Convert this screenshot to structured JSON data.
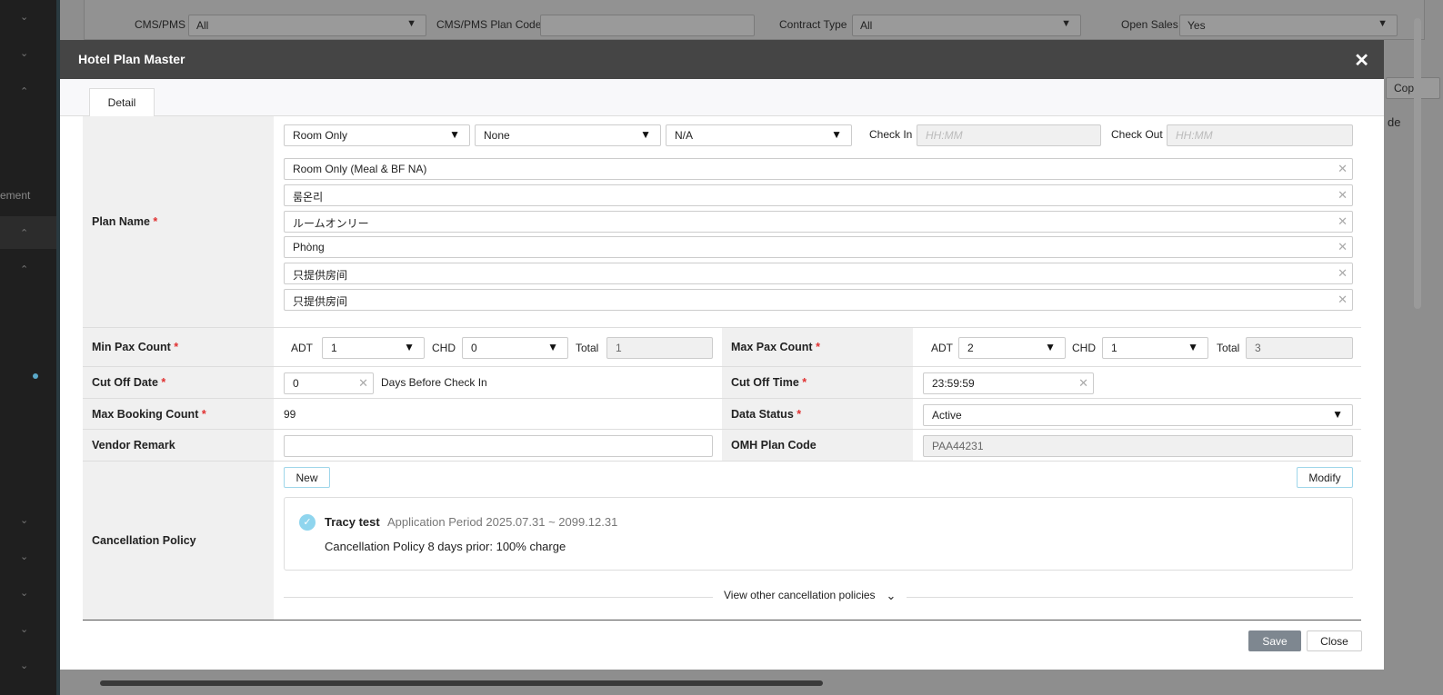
{
  "background": {
    "cms_pms_label": "CMS/PMS",
    "cms_pms_value": "All",
    "plan_code_label": "CMS/PMS Plan Code",
    "contract_type_label": "Contract Type",
    "contract_type_value": "All",
    "open_sales_label": "Open Sales",
    "open_sales_value": "Yes",
    "copy_button": "Copy",
    "col_fragment": "de",
    "sidebar_fragment": "ement"
  },
  "modal": {
    "title": "Hotel Plan Master",
    "close_icon": "close-icon",
    "tab": "Detail"
  },
  "plan": {
    "label": "Plan Name",
    "meal": "Room Only",
    "option2": "None",
    "option3": "N/A",
    "check_in_label": "Check In",
    "check_in_placeholder": "HH:MM",
    "check_out_label": "Check Out",
    "check_out_placeholder": "HH:MM",
    "names": [
      "Room Only (Meal & BF NA)",
      "룸온리",
      "ルームオンリー",
      "Phòng",
      "只提供房间",
      "只提供房间"
    ]
  },
  "min_pax": {
    "label": "Min Pax Count",
    "adt_label": "ADT",
    "adt": "1",
    "chd_label": "CHD",
    "chd": "0",
    "total_label": "Total",
    "total": "1"
  },
  "max_pax": {
    "label": "Max Pax Count",
    "adt_label": "ADT",
    "adt": "2",
    "chd_label": "CHD",
    "chd": "1",
    "total_label": "Total",
    "total": "3"
  },
  "cut_off_date": {
    "label": "Cut Off Date",
    "value": "0",
    "suffix": "Days Before Check In"
  },
  "cut_off_time": {
    "label": "Cut Off Time",
    "value": "23:59:59"
  },
  "max_booking": {
    "label": "Max Booking Count",
    "value": "99"
  },
  "data_status": {
    "label": "Data Status",
    "value": "Active"
  },
  "vendor_remark": {
    "label": "Vendor Remark",
    "value": ""
  },
  "omh_plan_code": {
    "label": "OMH Plan Code",
    "value": "PAA44231"
  },
  "cancellation": {
    "label": "Cancellation Policy",
    "new_button": "New",
    "modify_button": "Modify",
    "policy_name": "Tracy test",
    "period": "Application Period 2025.07.31 ~ 2099.12.31",
    "description": "Cancellation Policy 8 days prior: 100% charge",
    "view_other": "View other cancellation policies"
  },
  "footer": {
    "save": "Save",
    "close": "Close"
  }
}
